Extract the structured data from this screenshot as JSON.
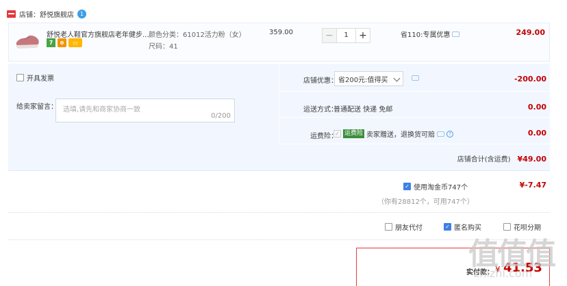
{
  "shop": {
    "label": "店铺：",
    "name": "舒悦旗舰店",
    "chat_badge": "1"
  },
  "item": {
    "title": "舒悦老人鞋官方旗舰店老年健步...",
    "spec_color": "颜色分类：61012活力粉（女）",
    "spec_size": "尺码：41",
    "unit_price": "359.00",
    "quantity": "1",
    "promo": "省110:专属优惠",
    "subtotal": "249.00",
    "badges": [
      "7",
      "",
      ""
    ]
  },
  "invoice": {
    "label": "开具发票"
  },
  "message": {
    "label": "给卖家留言：",
    "placeholder": "选填,请先和商家协商一致",
    "count": "0/200"
  },
  "shop_discount": {
    "label": "店铺优惠：",
    "selected": "省200元:值得买",
    "value": "-200.00"
  },
  "shipping": {
    "label": "运送方式：",
    "text": "普通配送 快递 免邮",
    "value": "0.00"
  },
  "insurance": {
    "label": "运费险：",
    "tag": "运费险",
    "text": "卖家赠送，退换货可赔",
    "value": "0.00"
  },
  "shop_total": {
    "label": "店铺合计(含运费)",
    "value": "¥49.00"
  },
  "coins": {
    "label": "使用淘金币747个",
    "value": "¥-7.47",
    "note": "（你有28812个，可用747个）"
  },
  "options": {
    "friend_pay": "朋友代付",
    "anonymous": "匿名购买",
    "installment": "花呗分期"
  },
  "pay": {
    "label": "实付款：",
    "currency": "¥",
    "amount": "41.53"
  },
  "watermark": {
    "main": "值值值",
    "sub": "zhizhi.com"
  }
}
